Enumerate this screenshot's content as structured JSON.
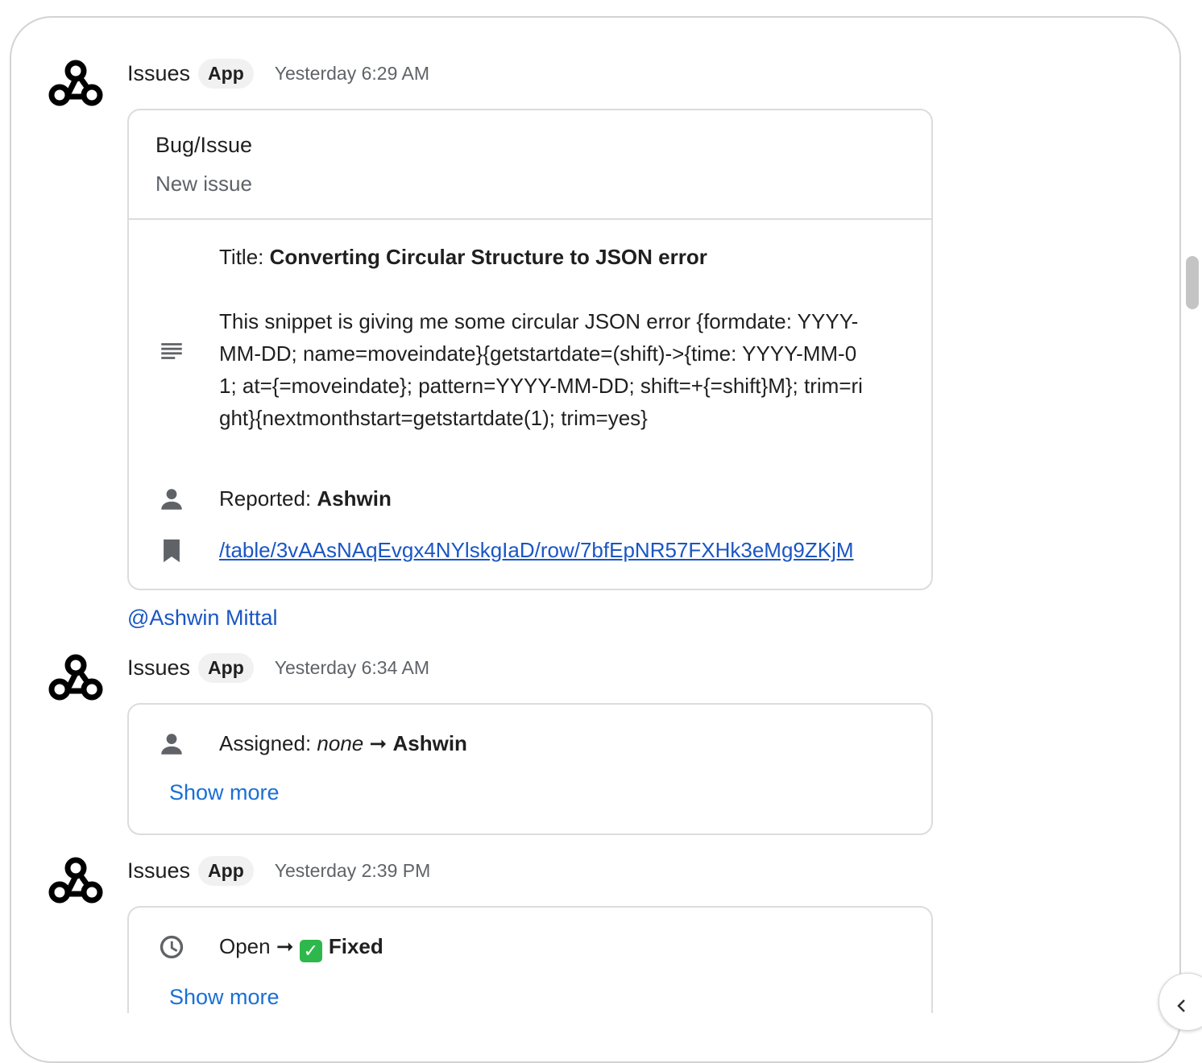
{
  "messages": [
    {
      "sender": "Issues",
      "badge": "App",
      "time": "Yesterday 6:29 AM",
      "card": {
        "title": "Bug/Issue",
        "subtitle": "New issue",
        "title_label": "Title: ",
        "title_value": "Converting Circular Structure to JSON error",
        "description": "This snippet is giving me some circular JSON error {formdate: YYYY-MM-DD; name=moveindate}{getstartdate=(shift)->{time: YYYY-MM-01; at={=moveindate}; pattern=YYYY-MM-DD; shift=+{=shift}M}; trim=right}{nextmonthstart=getstartdate(1); trim=yes}",
        "reported_label": "Reported: ",
        "reported_value": "Ashwin",
        "link_text": "/table/3vAAsNAqEvgx4NYlskgIaD/row/7bfEpNR57FXHk3eMg9ZKjM",
        "icons": [
          "notes-icon",
          "person-icon",
          "bookmark-icon"
        ]
      },
      "mention": "@Ashwin Mittal"
    },
    {
      "sender": "Issues",
      "badge": "App",
      "time": "Yesterday 6:34 AM",
      "card": {
        "assigned_label": "Assigned: ",
        "assigned_from": "none",
        "arrow": " ➞ ",
        "assigned_to": "Ashwin",
        "show_more": "Show more",
        "icons": [
          "person-icon"
        ]
      }
    },
    {
      "sender": "Issues",
      "badge": "App",
      "time": "Yesterday 2:39 PM",
      "card": {
        "status_from": "Open",
        "arrow": " ➞ ",
        "status_emoji": "✓",
        "status_to": "Fixed",
        "show_more": "Show more",
        "icons": [
          "clock-icon"
        ]
      }
    }
  ],
  "colors": {
    "link": "#1a56c4",
    "show_more": "#1a6fd4",
    "secondary_text": "#5f6368",
    "border": "#dcdcdc",
    "check": "#2eb84b"
  }
}
